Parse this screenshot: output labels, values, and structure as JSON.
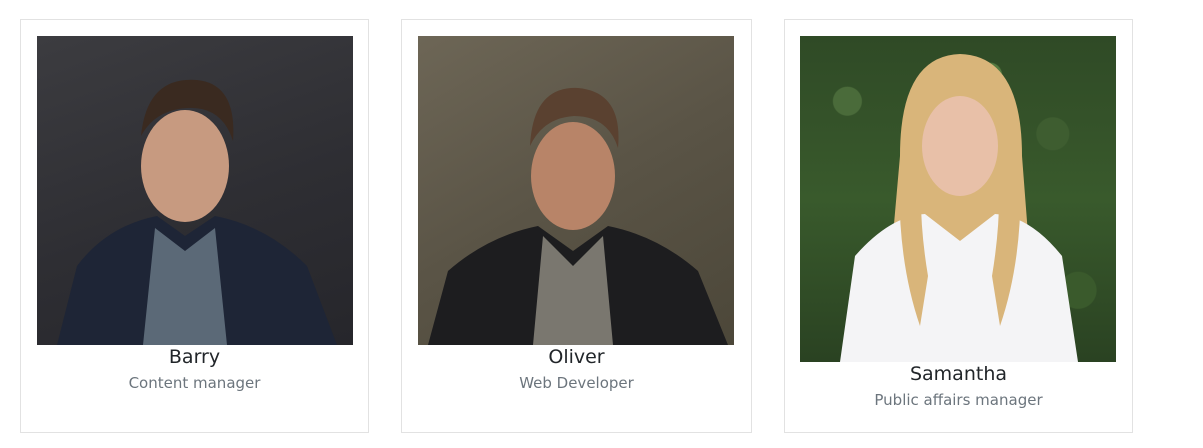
{
  "team": [
    {
      "name": "Barry",
      "role": "Content manager",
      "photo_alt": "portrait-photo"
    },
    {
      "name": "Oliver",
      "role": "Web Developer",
      "photo_alt": "portrait-photo"
    },
    {
      "name": "Samantha",
      "role": "Public affairs manager",
      "photo_alt": "portrait-photo"
    }
  ]
}
